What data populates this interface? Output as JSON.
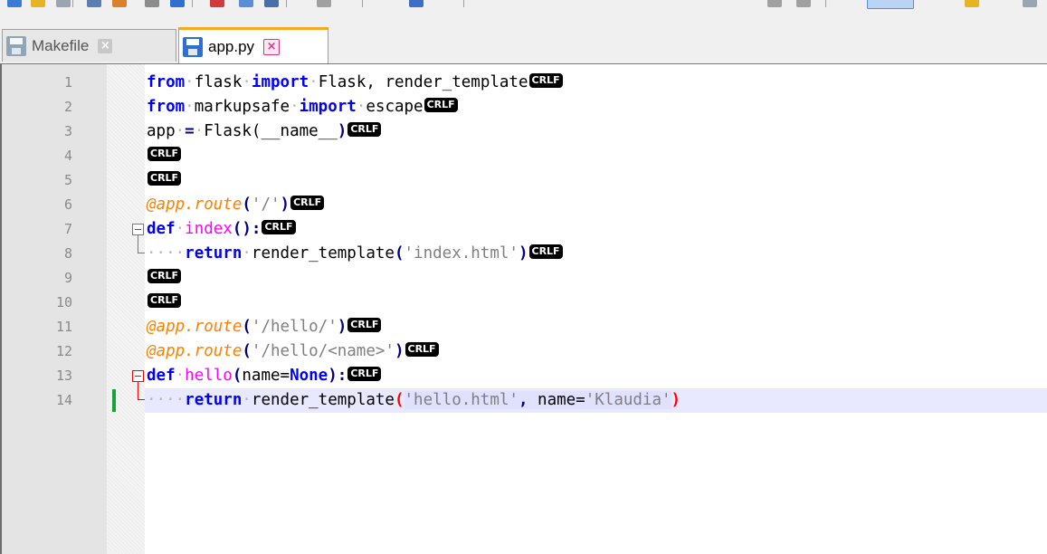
{
  "tabs": [
    {
      "label": "Makefile",
      "close": "×",
      "active": false
    },
    {
      "label": "app.py",
      "close": "×",
      "active": true
    }
  ],
  "line_numbers": [
    "1",
    "2",
    "3",
    "4",
    "5",
    "6",
    "7",
    "8",
    "9",
    "10",
    "11",
    "12",
    "13",
    "14"
  ],
  "eol_marker": {
    "cr": "CR",
    "lf": "LF"
  },
  "code": {
    "l1": {
      "from": "from",
      "mod": "flask",
      "import": "import",
      "names": "Flask, ",
      "name2": "render_template"
    },
    "l2": {
      "from": "from",
      "mod": "markupsafe",
      "import": "import",
      "name": "escape"
    },
    "l3": {
      "app": "app",
      "eq": "=",
      "call": "Flask(",
      "arg": "__name__",
      "close": ")"
    },
    "l6": {
      "deco": "@app.route",
      "open": "(",
      "str": "'/'",
      "close": ")"
    },
    "l7": {
      "def": "def",
      "fn": "index",
      "sig": "():"
    },
    "l8": {
      "indent": "····",
      "ret": "return",
      "call": "render_template",
      "open": "(",
      "str": "'index.html'",
      "close": ")"
    },
    "l11": {
      "deco": "@app.route",
      "open": "(",
      "str": "'/hello/'",
      "close": ")"
    },
    "l12": {
      "deco": "@app.route",
      "open": "(",
      "str": "'/hello/<name>'",
      "close": ")"
    },
    "l13": {
      "def": "def",
      "fn": "hello",
      "open": "(",
      "param": "name=",
      "none": "None",
      "close": "):"
    },
    "l14": {
      "indent": "····",
      "ret": "return",
      "call": "render_template",
      "open": "(",
      "str1": "'hello.html'",
      "comma": ", ",
      "kw": "name=",
      "str2": "'Klaudia'",
      "close": ")"
    }
  },
  "colors": {
    "keyword": "#0000ff",
    "string": "#808080",
    "function": "#ff00ff",
    "decorator": "#ff8000",
    "current_line": "#e8e8ff",
    "active_tab_accent": "#f8a81c",
    "change_marker": "#18a33a",
    "brace_highlight": "#ff0000"
  }
}
